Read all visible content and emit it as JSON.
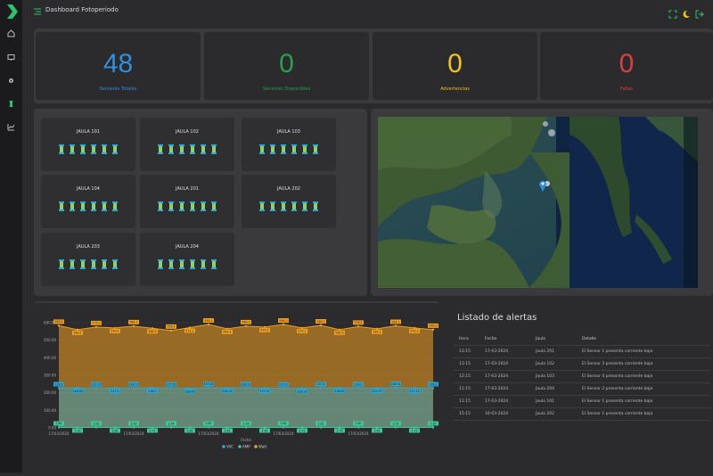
{
  "header": {
    "title": "Dashboard Fotoperiodo"
  },
  "colors": {
    "blue": "#2f8fdc",
    "green": "#2aa04a",
    "yellow": "#f0c419",
    "red": "#d94141",
    "accent_green": "#2ec26b"
  },
  "sidebar": {
    "icons": [
      "home-icon",
      "monitor-icon",
      "gear-icon",
      "sensor-icon",
      "chart-icon"
    ]
  },
  "stats": [
    {
      "value": "48",
      "label": "Sensores Totales",
      "color": "#2f8fdc"
    },
    {
      "value": "0",
      "label": "Sensores Disponibles",
      "color": "#2aa04a"
    },
    {
      "value": "0",
      "label": "Advertencias",
      "color": "#f0c419"
    },
    {
      "value": "0",
      "label": "Fallas",
      "color": "#d94141"
    }
  ],
  "cages": [
    {
      "name": "JAULA 101",
      "sensors": 6
    },
    {
      "name": "JAULA 102",
      "sensors": 6
    },
    {
      "name": "JAULA 103",
      "sensors": 6
    },
    {
      "name": "JAULA 104",
      "sensors": 6
    },
    {
      "name": "JAULA 201",
      "sensors": 6
    },
    {
      "name": "JAULA 202",
      "sensors": 6
    },
    {
      "name": "JAULA 203",
      "sensors": 6
    },
    {
      "name": "JAULA 204",
      "sensors": 6
    }
  ],
  "chart_data": {
    "type": "area",
    "x": [
      "17/03/2024",
      "",
      "",
      "",
      "17/03/2024",
      "",
      "",
      "",
      "17/03/2024",
      "",
      "",
      "",
      "17/03/2024",
      "",
      "",
      "",
      "17/03/2024",
      "",
      "",
      "",
      ""
    ],
    "xlabel": "Fecha",
    "ylabel": "",
    "ylim": [
      0,
      600
    ],
    "yticks": [
      "0.00",
      "100.00",
      "200.00",
      "300.00",
      "400.00",
      "500.00",
      "600.00"
    ],
    "series": [
      {
        "name": "Watt",
        "color": "#f0a020",
        "values": [
          583,
          560,
          575,
          570,
          580,
          568,
          555,
          572,
          590,
          565,
          580,
          575,
          590,
          570,
          585,
          560,
          578,
          565,
          582,
          570,
          560
        ]
      },
      {
        "name": "VAC",
        "color": "#2aa8d8",
        "values": [
          226,
          228,
          225,
          227,
          226,
          228,
          225,
          226,
          227,
          228,
          226,
          227,
          225,
          226,
          227,
          228,
          226,
          227,
          228,
          227,
          226
        ]
      },
      {
        "name": "AMP",
        "color": "#3ec99a",
        "values": [
          2.8,
          2.5,
          2.6,
          2.6,
          2.5,
          2.7,
          2.5,
          2.6,
          2.8,
          2.6,
          2.5,
          2.6,
          2.8,
          2.7,
          2.6,
          2.7,
          2.8,
          2.6,
          2.5,
          2.7,
          2.5
        ]
      }
    ],
    "data_labels": {
      "Watt": [
        "583.0",
        "560.2",
        "575.3",
        "570.4",
        "580.1",
        "568.3",
        "555.4",
        "572.2",
        "590.1",
        "565.4",
        "580.3",
        "575.2",
        "590.3",
        "570.1",
        "585.2",
        "560.3",
        "578.4",
        "565.2",
        "582.1",
        "570.3",
        "560.0"
      ],
      "VAC": [
        "226.3",
        "228.08",
        "225.25",
        "227.4",
        "226.15",
        "228.3",
        "225.52",
        "226.48",
        "227.16",
        "228.14",
        "226.22",
        "227.07",
        "225.21",
        "226.14",
        "227.4",
        "228.02",
        "226.2",
        "227.07",
        "228.01",
        "227.22",
        "226.0"
      ],
      "AMP": [
        "2.80",
        "2.50",
        "2.61",
        "2.62",
        "2.53",
        "2.71",
        "2.54",
        "2.62",
        "2.80",
        "2.63",
        "2.54",
        "2.62",
        "2.80",
        "2.71",
        "2.62",
        "2.70",
        "2.80",
        "2.62",
        "2.53",
        "2.72",
        "2.50"
      ]
    },
    "legend": [
      "VAC",
      "AMP",
      "Watt"
    ],
    "legend_position": "bottom"
  },
  "alerts": {
    "title": "Listado de alertas",
    "columns": [
      "Hora",
      "Fecha",
      "Jaula",
      "Detalle"
    ],
    "rows": [
      [
        "13:15",
        "17-03-2024",
        "Jaula 201",
        "El Sensor 1 presenta corriente baja"
      ],
      [
        "13:15",
        "17-03-2024",
        "Jaula 102",
        "El Sensor 3 presenta corriente baja"
      ],
      [
        "12:15",
        "17-03-2024",
        "Jaula 103",
        "El Sensor 4 presenta corriente baja"
      ],
      [
        "11:15",
        "17-03-2024",
        "Jaula 204",
        "El Sensor 2 presenta corriente baja"
      ],
      [
        "11:15",
        "17-03-2024",
        "Jaula 101",
        "El Sensor 1 presenta corriente baja"
      ],
      [
        "15:15",
        "16-03-2024",
        "Jaula 202",
        "El Sensor 1 presenta corriente baja"
      ]
    ]
  }
}
